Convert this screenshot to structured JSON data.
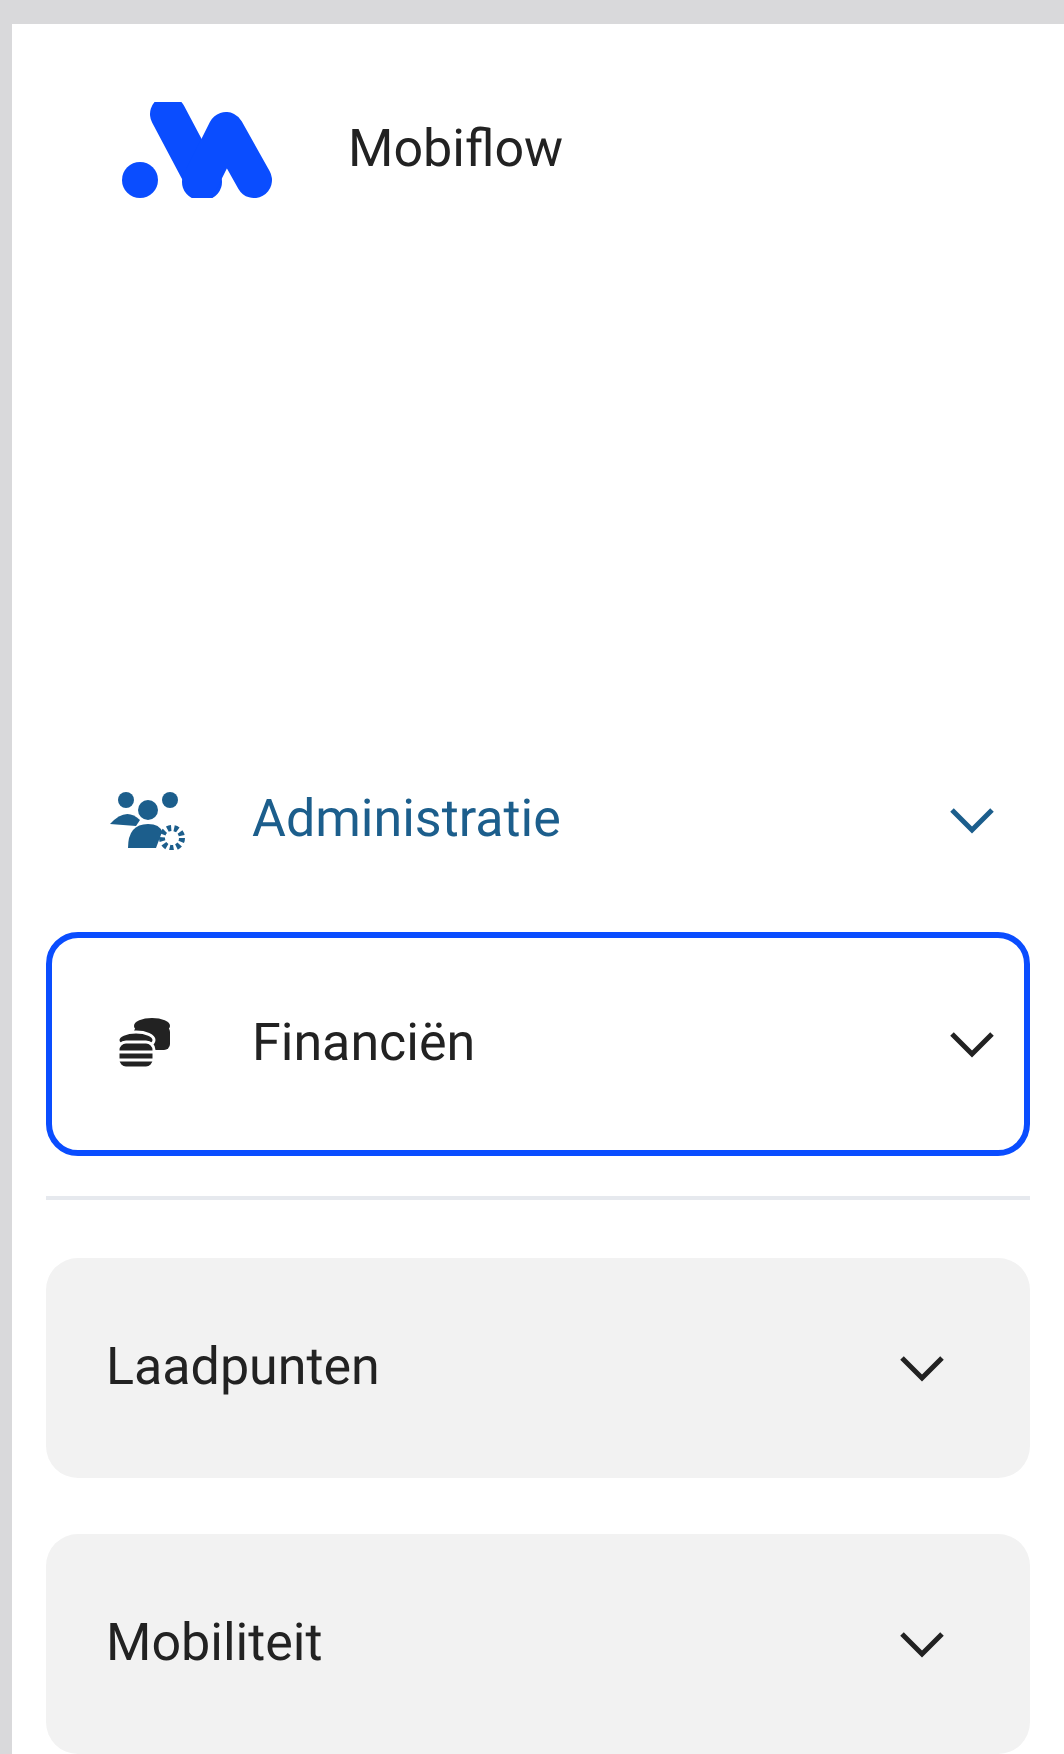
{
  "brand": {
    "name": "Mobiflow"
  },
  "nav_items": [
    {
      "label": "Administratie",
      "selected": true,
      "focused": false,
      "expanded": false
    },
    {
      "label": "Financiën",
      "selected": false,
      "focused": true,
      "expanded": false
    }
  ],
  "sections": [
    {
      "label": "Laadpunten",
      "expanded": false
    },
    {
      "label": "Mobiliteit",
      "expanded": false
    }
  ]
}
